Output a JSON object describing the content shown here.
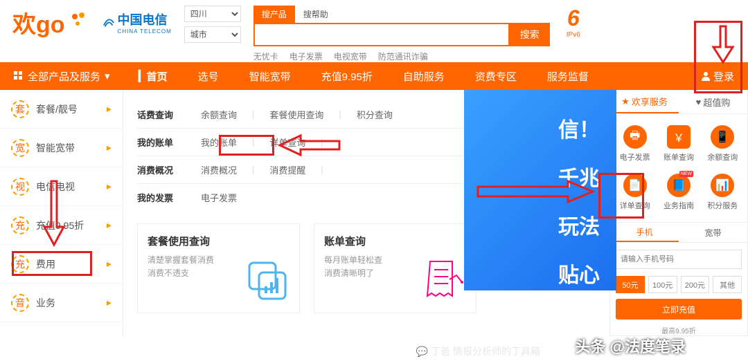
{
  "header": {
    "logo_text_1": "欢",
    "logo_text_2": "go",
    "telecom": "中国电信",
    "telecom_en": "CHINA TELECOM",
    "region_select": "四川",
    "city_select": "城市",
    "search_tab_product": "搜产品",
    "search_tab_help": "搜帮助",
    "search_placeholder": "",
    "search_btn": "搜索",
    "hot_links": [
      "无忧卡",
      "电子发票",
      "电视宽带",
      "防范通讯诈骗"
    ],
    "ipv6": "IPv6"
  },
  "nav": {
    "all": "全部产品及服务",
    "items": [
      "首页",
      "选号",
      "智能宽带",
      "充值9.95折",
      "自助服务",
      "资费专区",
      "服务监督"
    ],
    "login": "登录"
  },
  "side": {
    "items": [
      {
        "icon": "套",
        "label": "套餐/靓号"
      },
      {
        "icon": "宽",
        "label": "智能宽带"
      },
      {
        "icon": "视",
        "label": "电信电视"
      },
      {
        "icon": "充",
        "label": "充值9.95折"
      },
      {
        "icon": "充",
        "label": "费用"
      },
      {
        "icon": "音",
        "label": "业务"
      }
    ]
  },
  "content": {
    "rows": [
      {
        "label": "话费查询",
        "items": [
          "余额查询",
          "套餐使用查询",
          "积分查询"
        ]
      },
      {
        "label": "我的账单",
        "items": [
          "我的账单",
          "详单查询"
        ]
      },
      {
        "label": "消费概况",
        "items": [
          "消费概况",
          "消费提醒"
        ]
      },
      {
        "label": "我的发票",
        "items": [
          "电子发票"
        ]
      }
    ],
    "cards": [
      {
        "title": "套餐使用查询",
        "desc1": "清楚掌握套餐消费",
        "desc2": "消费不透支"
      },
      {
        "title": "账单查询",
        "desc1": "每月账单轻松查",
        "desc2": "消费清晰明了"
      }
    ]
  },
  "banner": {
    "l1": "信！",
    "l2": "千兆",
    "l3": "玩法",
    "l4": "贴心"
  },
  "rpanel": {
    "tabs": [
      {
        "icon": "★",
        "label": "欢享服务"
      },
      {
        "icon": "♥",
        "label": "超值购"
      }
    ],
    "grid": [
      {
        "name": "电子发票"
      },
      {
        "name": "账单查询"
      },
      {
        "name": "余额查询"
      },
      {
        "name": "详单查询"
      },
      {
        "name": "业务指南",
        "badge": "NEW"
      },
      {
        "name": "积分服务"
      }
    ],
    "tabs2": [
      "手机",
      "宽带"
    ],
    "phone_placeholder": "请输入手机号码",
    "amounts": [
      "50元",
      "100元",
      "200元",
      "其他"
    ],
    "pay_btn": "立即充值",
    "discount": "最高9.95折"
  },
  "watermark": {
    "w1": "头条 @法度笔录",
    "w2": "丁爸 情报分析师的丁具箱"
  }
}
